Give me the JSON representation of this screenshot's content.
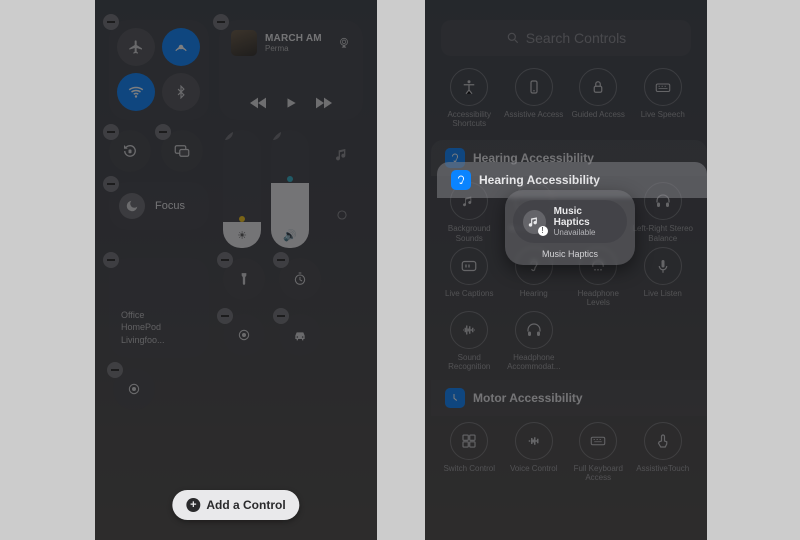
{
  "left": {
    "connectivity": {
      "airdrop_on": true,
      "wifi_on": true,
      "bluetooth_on": true
    },
    "media": {
      "title": "MARCH AM",
      "artist": "Perma"
    },
    "focus_label": "Focus",
    "home_tile": {
      "line1": "Office",
      "line2": "HomePod",
      "line3": "Livingfoo..."
    },
    "add_control_label": "Add a Control"
  },
  "right": {
    "search_placeholder": "Search Controls",
    "top_items": [
      {
        "label": "Accessibility Shortcuts"
      },
      {
        "label": "Assistive Access"
      },
      {
        "label": "Guided Access"
      },
      {
        "label": "Live Speech"
      }
    ],
    "hearing_header": "Hearing Accessibility",
    "popover": {
      "title": "Music Haptics",
      "subtitle": "Unavailable",
      "caption": "Music Haptics"
    },
    "hearing_items": [
      {
        "label": "Background Sounds"
      },
      {
        "label": "Music Haptics"
      },
      {
        "label": "Left-Right Stereo Balance"
      },
      {
        "label": "Live Captions"
      },
      {
        "label": "Hearing"
      },
      {
        "label": "Headphone Levels"
      },
      {
        "label": "Live Listen"
      },
      {
        "label": "Sound Recognition"
      },
      {
        "label": "Headphone Accommodat..."
      }
    ],
    "motor_header": "Motor Accessibility",
    "motor_items": [
      {
        "label": "Switch Control"
      },
      {
        "label": "Voice Control"
      },
      {
        "label": "Full Keyboard Access"
      },
      {
        "label": "AssistiveTouch"
      }
    ]
  }
}
